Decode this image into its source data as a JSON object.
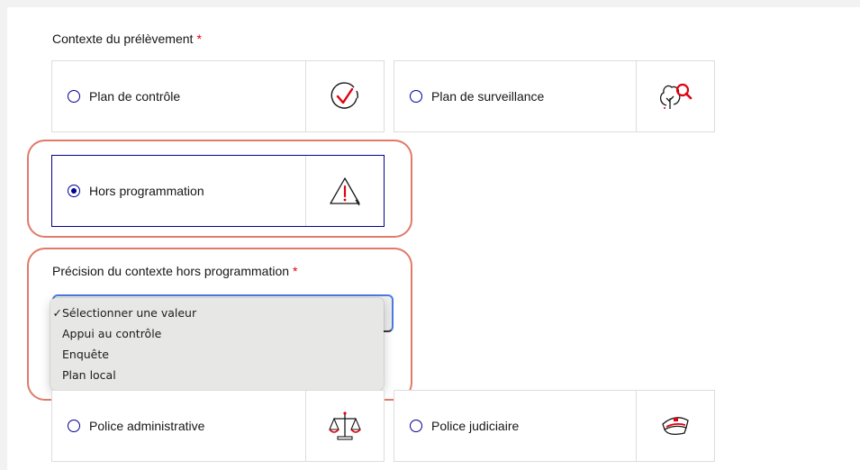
{
  "context_field": {
    "label": "Contexte du prélèvement",
    "required_mark": "*"
  },
  "tiles": {
    "plan_controle": {
      "label": "Plan de contrôle",
      "selected": false,
      "picto": "checkmark-circle-icon"
    },
    "plan_surveillance": {
      "label": "Plan de surveillance",
      "selected": false,
      "picto": "tree-magnifier-icon"
    },
    "hors_programmation": {
      "label": "Hors programmation",
      "selected": true,
      "picto": "warning-triangle-icon"
    },
    "police_administrative": {
      "label": "Police administrative",
      "selected": false,
      "picto": "scales-icon"
    },
    "police_judiciaire": {
      "label": "Police judiciaire",
      "selected": false,
      "picto": "police-cap-icon"
    }
  },
  "precision_field": {
    "label": "Précision du contexte hors programmation",
    "required_mark": "*",
    "selected_value": "Sélectionner une valeur",
    "options": [
      "Sélectionner une valeur",
      "Appui au contrôle",
      "Enquête",
      "Plan local"
    ],
    "check_mark": "✓"
  },
  "colors": {
    "primary": "#000091",
    "required": "#e1000f",
    "highlight": "#e07a6a",
    "select_focus": "#4a7ce0"
  }
}
